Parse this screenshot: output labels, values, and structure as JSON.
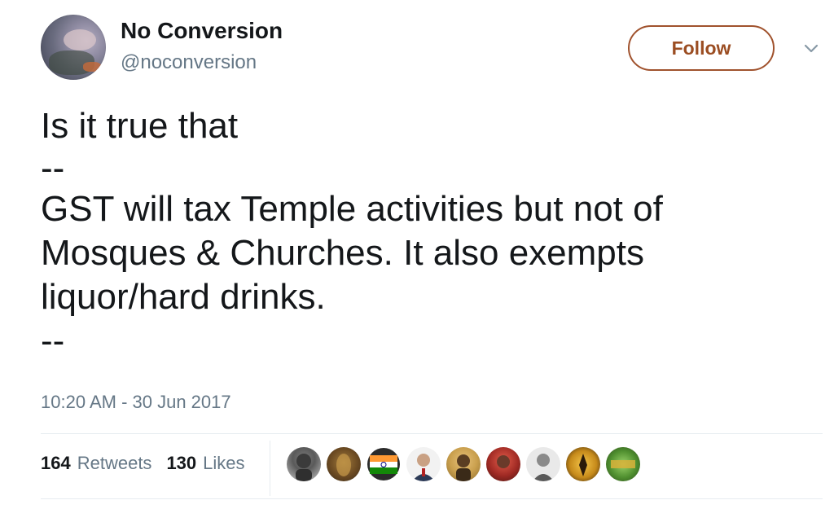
{
  "author": {
    "display_name": "No Conversion",
    "screen_name": "@noconversion",
    "avatar_icon": "profile-photo"
  },
  "follow_label": "Follow",
  "accent_color": "#a0522d",
  "tweet": {
    "lines": [
      "Is it true that",
      "--",
      "GST will tax Temple activities but not of Mosques & Churches. It also exempts liquor/hard drinks.",
      "--"
    ]
  },
  "timestamp": "10:20 AM - 30 Jun 2017",
  "stats": {
    "retweets_count": "164",
    "retweets_label": "Retweets",
    "likes_count": "130",
    "likes_label": "Likes"
  },
  "likers_icons": [
    "liker-avatar-1",
    "liker-avatar-2",
    "liker-avatar-3",
    "liker-avatar-4",
    "liker-avatar-5",
    "liker-avatar-6",
    "liker-avatar-7",
    "liker-avatar-8",
    "liker-avatar-9"
  ]
}
